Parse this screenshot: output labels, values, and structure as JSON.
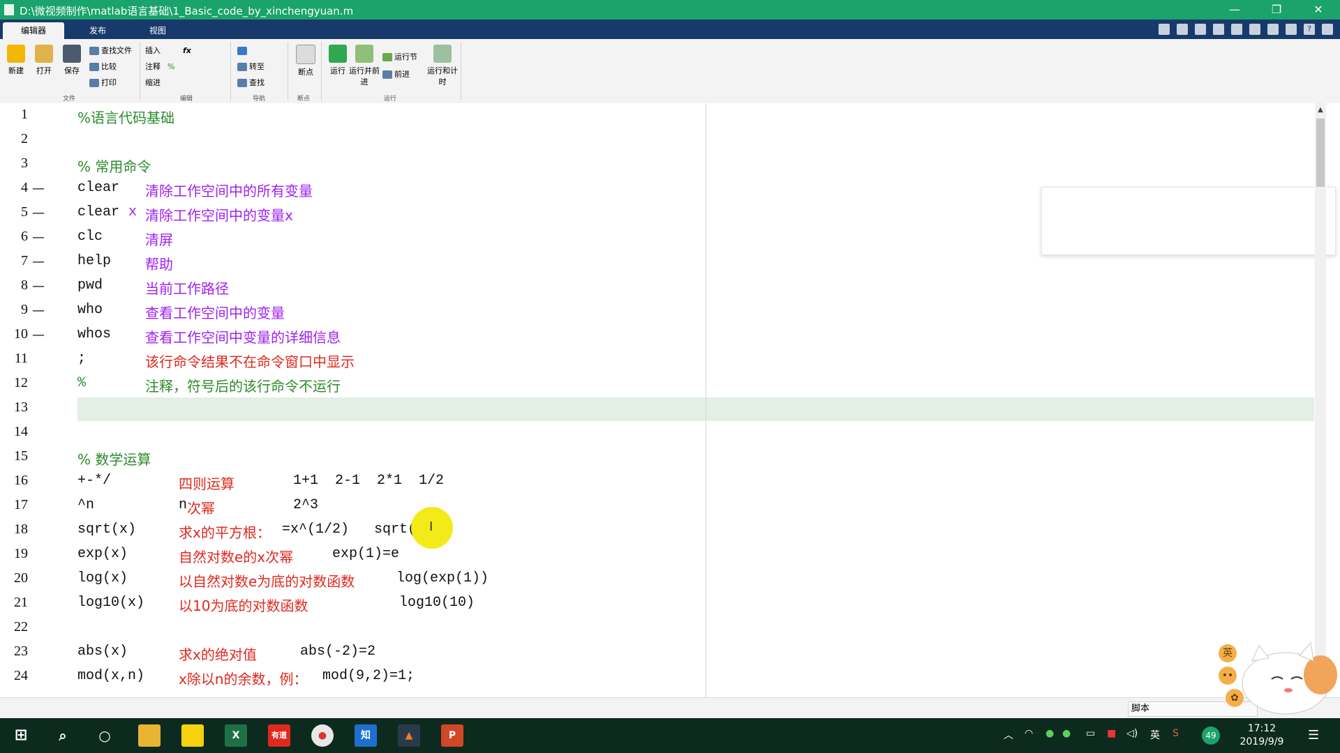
{
  "window": {
    "title": "D:\\微视频制作\\matlab语言基础\\1_Basic_code_by_xinchengyuan.m",
    "controls": [
      "—",
      "❐",
      "✕"
    ]
  },
  "tabs": [
    "编辑器",
    "发布",
    "视图"
  ],
  "ribbon": {
    "file": {
      "new": "新建",
      "open": "打开",
      "save": "保存",
      "find_files": "查找文件",
      "compare": "比较",
      "print": "打印",
      "group": "文件"
    },
    "edit": {
      "insert": "插入",
      "fx": "fx",
      "comment": "注释",
      "indent": "缩进",
      "group": "编辑"
    },
    "navigate": {
      "goto": "转至",
      "find": "查找",
      "group": "导航"
    },
    "breakpoints": {
      "label": "断点",
      "group": "断点"
    },
    "run": {
      "run": "运行",
      "run_advance": "运行并前进",
      "run_section": "运行节",
      "advance": "前进",
      "run_time": "运行和计时",
      "group": "运行"
    }
  },
  "editor": {
    "line_numbers": [
      "1",
      "2",
      "3",
      "4",
      "5",
      "6",
      "7",
      "8",
      "9",
      "10",
      "11",
      "12",
      "13",
      "14",
      "15",
      "16",
      "17",
      "18",
      "19",
      "20",
      "21",
      "22",
      "23",
      "24"
    ],
    "dash": "—",
    "lines": {
      "l1": "%语言代码基础",
      "l3": "% 常用命令",
      "l4": {
        "cmd": "clear",
        "desc": "清除工作空间中的所有变量"
      },
      "l5": {
        "cmd": "clear",
        "x": "x",
        "desc": "清除工作空间中的变量x"
      },
      "l6": {
        "cmd": "clc",
        "desc": "清屏"
      },
      "l7": {
        "cmd": "help",
        "desc": "帮助"
      },
      "l8": {
        "cmd": "pwd",
        "desc": "当前工作路径"
      },
      "l9": {
        "cmd": "who",
        "desc": "查看工作空间中的变量"
      },
      "l10": {
        "cmd": "whos",
        "desc": "查看工作空间中变量的详细信息"
      },
      "l11": {
        "cmd": ";",
        "desc": "该行命令结果不在命令窗口中显示"
      },
      "l12": {
        "cmd": "%",
        "desc": "注释，符号后的该行命令不运行"
      },
      "l15": "% 数学运算",
      "l16": {
        "cmd": "+-*/",
        "desc": "四则运算",
        "ex": "1+1  2-1  2*1  1/2"
      },
      "l17": {
        "cmd": "^n",
        "desc_pre": "n",
        "desc": "次幂",
        "ex": "2^3"
      },
      "l18": {
        "cmd": "sqrt(x)",
        "desc": "求x的平方根：",
        "ex": "=x^(1/2)   sqrt(4)"
      },
      "l19": {
        "cmd": "exp(x)",
        "desc": "自然对数e的x次幂",
        "ex": "exp(1)=e"
      },
      "l20": {
        "cmd": "log(x)",
        "desc": "以自然对数e为底的对数函数",
        "ex": "log(exp(1))"
      },
      "l21": {
        "cmd": "log10(x)",
        "desc": "以10为底的对数函数",
        "ex": "log10(10)"
      },
      "l23": {
        "cmd": "abs(x)",
        "desc": "求x的绝对值",
        "ex": "abs(-2)=2"
      },
      "l24": {
        "cmd": "mod(x,n)",
        "desc": "x除以n的余数，例：",
        "ex": "mod(9,2)=1;"
      }
    }
  },
  "status": {
    "file_type": "脚本"
  },
  "ime": {
    "lang": "英"
  },
  "taskbar": {
    "apps": [
      "文件资源管理器",
      "便笺",
      "Excel",
      "有道",
      "Chrome",
      "知",
      "MATLAB",
      "PowerPoint"
    ],
    "tray_lang": "英",
    "badge": "49",
    "time": "17:12",
    "date": "2019/9/9"
  }
}
